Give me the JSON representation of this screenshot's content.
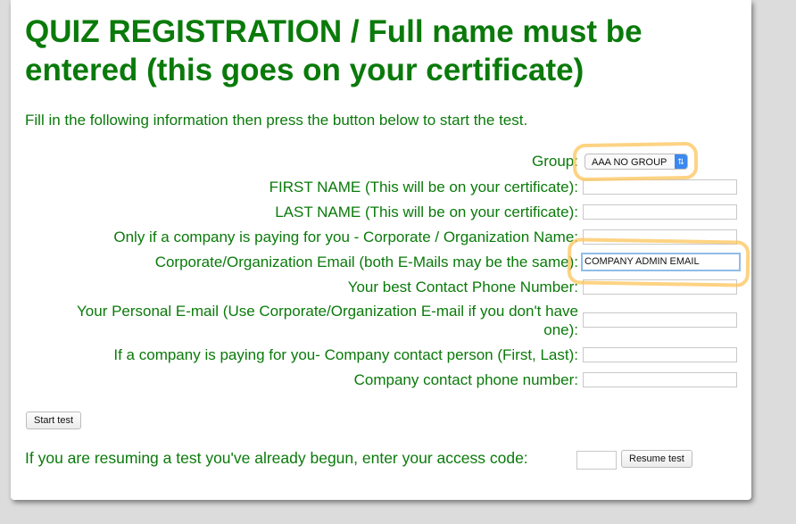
{
  "page": {
    "title": "QUIZ REGISTRATION / Full name must be entered (this goes on your certificate)",
    "intro": "Fill in the following information then press the button below to start the test."
  },
  "form": {
    "group": {
      "label": "Group:",
      "selected": "AAA NO GROUP"
    },
    "fields": [
      {
        "label": "FIRST NAME (This will be on your certificate):",
        "value": ""
      },
      {
        "label": "LAST NAME (This will be on your certificate):",
        "value": ""
      },
      {
        "label": "Only if a company is paying for you - Corporate / Organization Name:",
        "value": ""
      },
      {
        "label": "Corporate/Organization Email (both E-Mails may be the same):",
        "value": "COMPANY ADMIN EMAIL"
      },
      {
        "label": "Your best Contact Phone Number:",
        "value": ""
      },
      {
        "label": "Your Personal E-mail (Use Corporate/Organization E-mail if you don't have one):",
        "value": ""
      },
      {
        "label": "If a company is paying for you- Company contact person (First, Last):",
        "value": ""
      },
      {
        "label": "Company contact phone number:",
        "value": ""
      }
    ],
    "start_label": "Start test"
  },
  "resume": {
    "text": "If you are resuming a test you've already begun, enter your access code:",
    "code_value": "",
    "button_label": "Resume test"
  }
}
